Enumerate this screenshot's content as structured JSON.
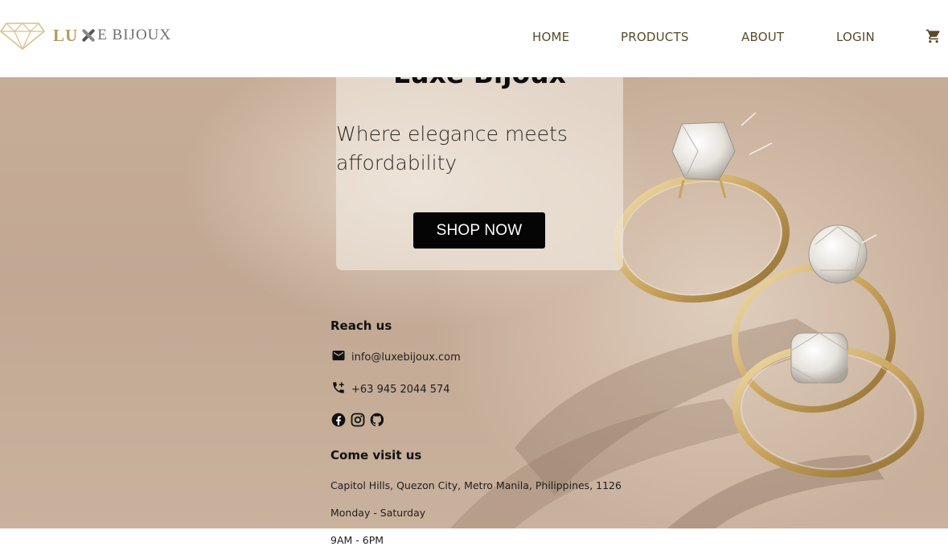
{
  "brand": {
    "logo_lu": "LU",
    "logo_rest": "E BIJOUX",
    "logo_gold": "#d8c08a"
  },
  "nav": {
    "items": [
      "HOME",
      "PRODUCTS",
      "ABOUT",
      "LOGIN"
    ],
    "text_color": "#5a4a2c"
  },
  "hero": {
    "title": "Luxe Bijoux",
    "tagline": "Where elegance meets affordability",
    "cta_label": "SHOP NOW"
  },
  "contact": {
    "reach_heading": "Reach us",
    "email": "info@luxebijoux.com",
    "phone": "+63 945 2044 574",
    "social_icons": [
      "facebook-icon",
      "instagram-icon",
      "github-icon"
    ],
    "visit_heading": "Come visit us",
    "address": "Capitol Hills, Quezon City, Metro Manila, Philippines, 1126",
    "days": "Monday - Saturday",
    "hours": "9AM - 6PM"
  },
  "icons": {
    "cart": "cart-icon",
    "email": "email-icon",
    "phone": "phone-icon",
    "logo": "diamond-logo-icon"
  }
}
